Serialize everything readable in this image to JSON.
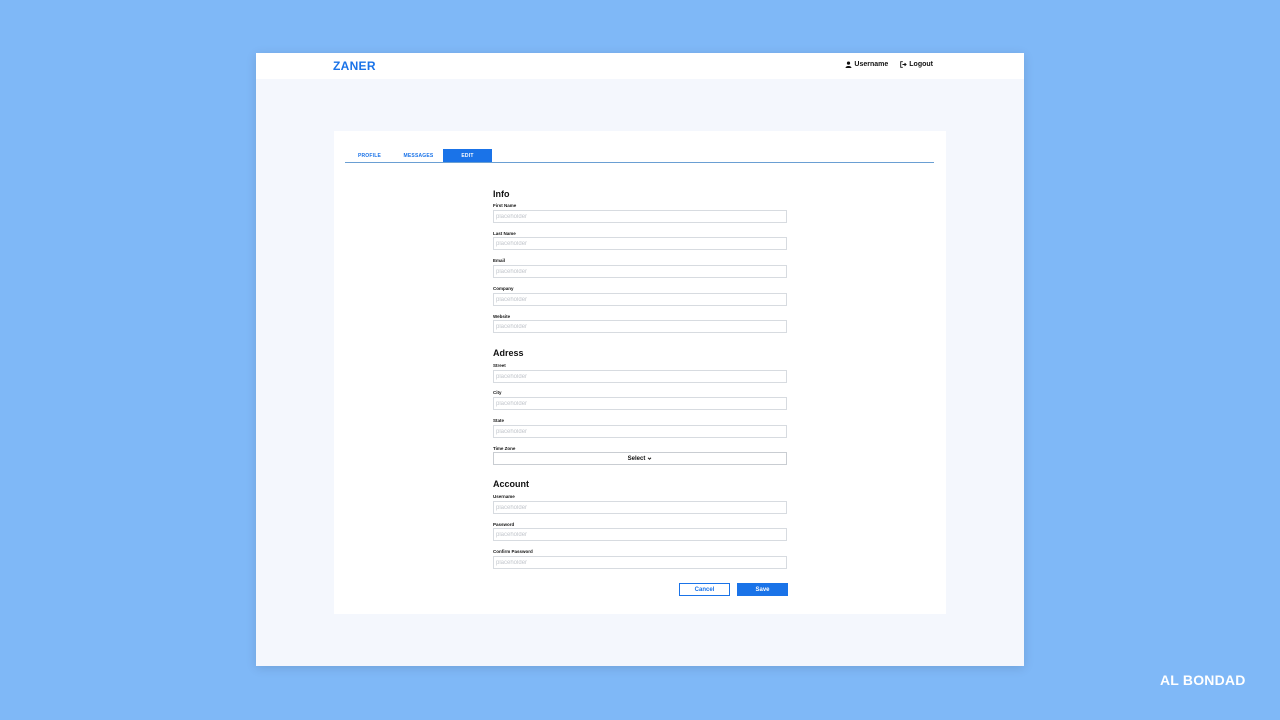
{
  "header": {
    "logo": "ZANER",
    "username_label": "Username",
    "logout_label": "Logout"
  },
  "tabs": [
    {
      "label": "PROFILE",
      "active": false
    },
    {
      "label": "MESSAGES",
      "active": false
    },
    {
      "label": "EDIT",
      "active": true
    }
  ],
  "sections": {
    "info": {
      "title": "Info",
      "fields": [
        {
          "label": "First Name",
          "placeholder": "placeholder"
        },
        {
          "label": "Last Name",
          "placeholder": "placeholder"
        },
        {
          "label": "Email",
          "placeholder": "placeholder"
        },
        {
          "label": "Company",
          "placeholder": "placeholder"
        },
        {
          "label": "Website",
          "placeholder": "placeholder"
        }
      ]
    },
    "address": {
      "title": "Adress",
      "fields": [
        {
          "label": "Street",
          "placeholder": "placeholder"
        },
        {
          "label": "City",
          "placeholder": "placeholder"
        },
        {
          "label": "State",
          "placeholder": "placeholder"
        }
      ],
      "timezone": {
        "label": "Time Zone",
        "value": "Select"
      }
    },
    "account": {
      "title": "Account",
      "fields": [
        {
          "label": "Username",
          "placeholder": "placeholder"
        },
        {
          "label": "Password",
          "placeholder": "placeholder"
        },
        {
          "label": "Confirm Password",
          "placeholder": "placeholder"
        }
      ]
    }
  },
  "actions": {
    "cancel_label": "Cancel",
    "save_label": "Save"
  },
  "watermark": "AL BONDAD",
  "colors": {
    "page_background": "#7fb8f7",
    "accent": "#1a73e8",
    "window_background": "#f4f7fd"
  },
  "icons": {
    "user": "user-icon",
    "logout": "logout-icon",
    "dropdown": "chevron-down-icon"
  }
}
